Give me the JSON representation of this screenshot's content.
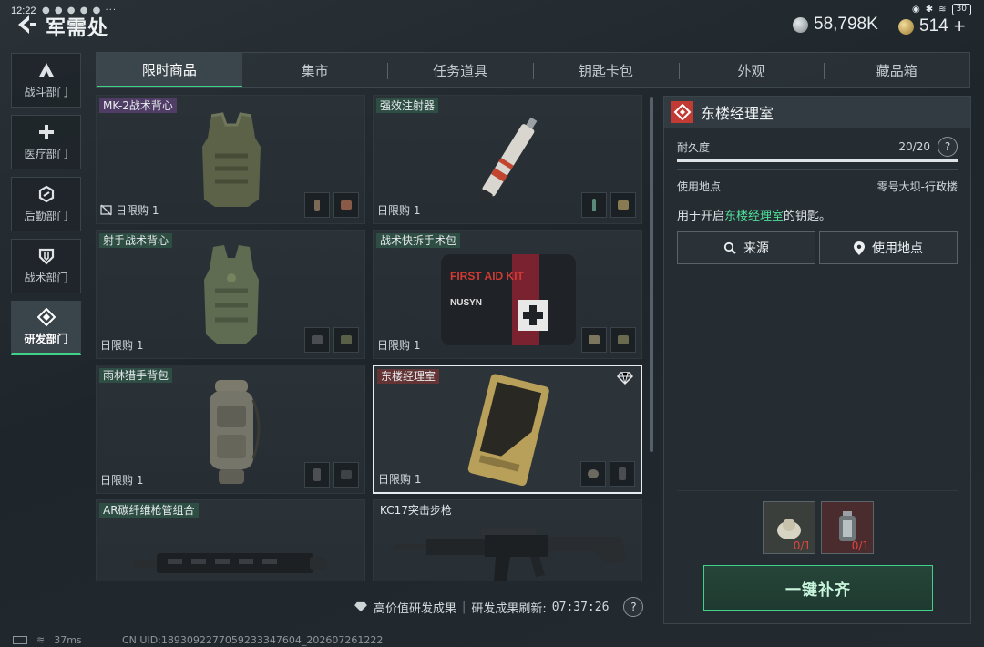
{
  "status": {
    "time": "12:22",
    "dots": "● ● ● ● ● ···",
    "battery": "30"
  },
  "header": {
    "title": "军需处",
    "currency_1": "58,798K",
    "currency_2": "514",
    "plus": "+"
  },
  "sidebar": {
    "items": [
      {
        "label": "战斗部门",
        "icon": "combat-icon"
      },
      {
        "label": "医疗部门",
        "icon": "medical-cross-icon"
      },
      {
        "label": "后勤部门",
        "icon": "logistics-icon"
      },
      {
        "label": "战术部门",
        "icon": "tactical-shield-icon"
      },
      {
        "label": "研发部门",
        "icon": "research-icon",
        "active": true
      }
    ]
  },
  "tabs": [
    "限时商品",
    "集市",
    "任务道具",
    "钥匙卡包",
    "外观",
    "藏品箱"
  ],
  "active_tab": 0,
  "items": [
    {
      "name": "MK-2战术背心",
      "limit": "日限购 1",
      "tag": "purple",
      "icon": "tactical-vest-icon",
      "limit_icon": true
    },
    {
      "name": "强效注射器",
      "limit": "日限购 1",
      "tag": "green",
      "icon": "injector-icon"
    },
    {
      "name": "射手战术背心",
      "limit": "日限购 1",
      "tag": "green",
      "icon": "tactical-vest-icon"
    },
    {
      "name": "战术快拆手术包",
      "limit": "日限购 1",
      "tag": "green",
      "icon": "first-aid-kit-icon",
      "kit_label": "FIRST AID KIT",
      "kit_brand": "NUSYN"
    },
    {
      "name": "雨林猎手背包",
      "limit": "日限购 1",
      "tag": "green",
      "icon": "backpack-icon"
    },
    {
      "name": "东楼经理室",
      "limit": "日限购 1",
      "tag": "red",
      "icon": "keycard-icon",
      "selected": true,
      "gem": true
    },
    {
      "name": "AR碳纤维枪管组合",
      "limit": "",
      "tag": "green",
      "icon": "barrel-icon"
    },
    {
      "name": "KC17突击步枪",
      "limit": "",
      "tag": "none",
      "icon": "rifle-icon"
    }
  ],
  "footer": {
    "high_value": "高价值研发成果",
    "refresh_label": "研发成果刷新:",
    "refresh_time": "07:37:26",
    "help": "?",
    "ping": "37ms",
    "uid": "CN UID:1893092277059233347604_202607261222"
  },
  "detail": {
    "title": "东楼经理室",
    "durability_label": "耐久度",
    "durability_value": "20/20",
    "durability_fraction": 1.0,
    "location_label": "使用地点",
    "location_value": "零号大坝-行政楼",
    "desc_prefix": "用于开启",
    "desc_highlight": "东楼经理室",
    "desc_suffix": "的钥匙。",
    "btn_source": "来源",
    "btn_location": "使用地点",
    "req_1_count": "0/1",
    "req_2_count": "0/1",
    "main_button": "一键补齐",
    "help": "?"
  },
  "colors": {
    "accent_green": "#3fd38a",
    "highlight_green": "#4fe09a",
    "warning_red": "#e2443e"
  }
}
